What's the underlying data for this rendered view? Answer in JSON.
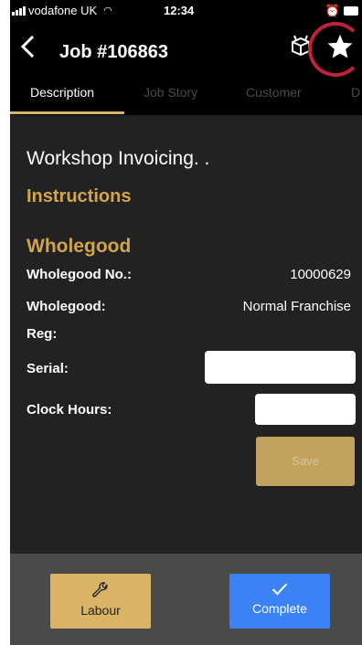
{
  "status_bar": {
    "carrier": "vodafone UK",
    "time": "12:34"
  },
  "header": {
    "title": "Job #106863"
  },
  "tabs": [
    {
      "label": "Description",
      "active": true
    },
    {
      "label": "Job Story",
      "active": false
    },
    {
      "label": "Customer",
      "active": false
    },
    {
      "label": "D",
      "active": false
    }
  ],
  "content": {
    "title": "Workshop Invoicing. .",
    "instructions_heading": "Instructions",
    "wholegood_heading": "Wholegood",
    "fields": {
      "wholegood_no_label": "Wholegood No.:",
      "wholegood_no_value": "10000629",
      "wholegood_label": "Wholegood:",
      "wholegood_value": "Normal Franchise",
      "reg_label": "Reg:",
      "serial_label": "Serial:",
      "serial_value": "",
      "clock_hours_label": "Clock Hours:",
      "clock_hours_value": ""
    },
    "save_label": "Save"
  },
  "footer": {
    "labour_label": "Labour",
    "complete_label": "Complete"
  },
  "colors": {
    "accent_gold": "#d1a54c",
    "button_gold": "#d9b466",
    "complete_blue": "#3b82f6",
    "highlight_ring": "#c0213a",
    "background": "#222222",
    "footer_bg": "#4a4a4a"
  },
  "icons": {
    "back": "chevron-left-icon",
    "box": "open-box-icon",
    "star": "star-icon",
    "labour": "wrench-icon",
    "complete": "checkmark-icon"
  }
}
